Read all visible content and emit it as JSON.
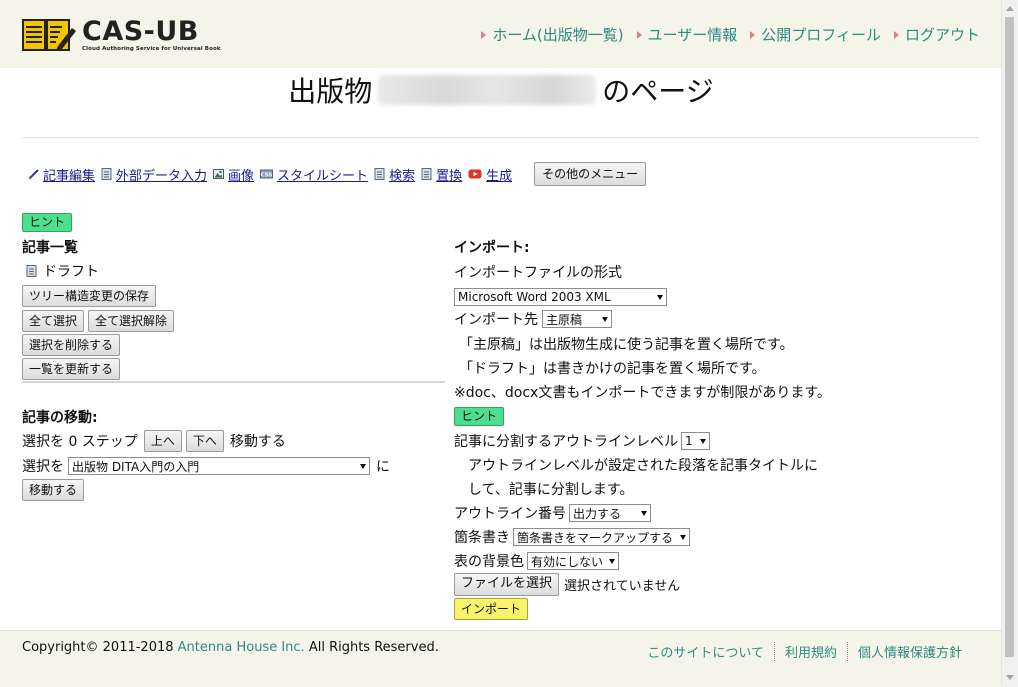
{
  "header": {
    "logo": {
      "name": "CAS-UB",
      "subtitle": "Cloud Authoring Service for Universal Book"
    },
    "nav": [
      {
        "label": "ホーム(出版物一覧)"
      },
      {
        "label": "ユーザー情報"
      },
      {
        "label": "公開プロフィール"
      },
      {
        "label": "ログアウト"
      }
    ]
  },
  "title": {
    "prefix": "出版物",
    "suffix": "のページ"
  },
  "toolbar": {
    "items": [
      {
        "label": "記事編集",
        "icon": "pencil-icon"
      },
      {
        "label": "外部データ入力",
        "icon": "document-icon"
      },
      {
        "label": "画像",
        "icon": "image-icon"
      },
      {
        "label": "スタイルシート",
        "icon": "css-icon"
      },
      {
        "label": "検索",
        "icon": "document-icon"
      },
      {
        "label": "置換",
        "icon": "document-icon"
      },
      {
        "label": "生成",
        "icon": "play-icon"
      }
    ],
    "menu_button": "その他のメニュー"
  },
  "left": {
    "hint": "ヒント",
    "article_list_heading": "記事一覧",
    "draft_label": "ドラフト",
    "save_tree_button": "ツリー構造変更の保存",
    "select_all_button": "全て選択",
    "deselect_all_button": "全て選択解除",
    "delete_selection_button": "選択を削除する",
    "refresh_list_button": "一覧を更新する",
    "move_heading": "記事の移動:",
    "move_steps_text": "選択を 0 ステップ",
    "up_button": "上へ",
    "down_button": "下へ",
    "move_suffix": "移動する",
    "move_to_prefix": "選択を",
    "move_target_value": "出版物 DITA入門の入門",
    "move_to_suffix": "に",
    "move_button": "移動する"
  },
  "right": {
    "import_heading": "インポート:",
    "format_label": "インポートファイルの形式",
    "format_value": "Microsoft Word 2003 XML",
    "dest_label": "インポート先",
    "dest_value": "主原稿",
    "dest_note1": "「主原稿」は出版物生成に使う記事を置く場所です。",
    "dest_note2": "「ドラフト」は書きかけの記事を置く場所です。",
    "doc_note": "※doc、docx文書もインポートできますが制限があります。",
    "hint": "ヒント",
    "outline_label": "記事に分割するアウトラインレベル",
    "outline_value": "1",
    "outline_note1": "アウトラインレベルが設定された段落を記事タイトルに",
    "outline_note2": "して、記事に分割します。",
    "outline_number_label": "アウトライン番号",
    "outline_number_value": "出力する",
    "bullets_label": "箇条書き",
    "bullets_value": "箇条書きをマークアップする",
    "table_bg_label": "表の背景色",
    "table_bg_value": "有効にしない",
    "file_button": "ファイルを選択",
    "file_status": "選択されていません",
    "import_button": "インポート"
  },
  "footer": {
    "copyright": "Copyright© 2011-2018",
    "company": "Antenna House Inc.",
    "rights": "All Rights Reserved.",
    "links": [
      {
        "label": "このサイトについて"
      },
      {
        "label": "利用規約"
      },
      {
        "label": "個人情報保護方針"
      }
    ]
  },
  "colors": {
    "header_bg": "#f4f5e8",
    "link_teal": "#2f8a84",
    "hint_green": "#4dde8e",
    "import_yellow": "#f7f36a"
  }
}
